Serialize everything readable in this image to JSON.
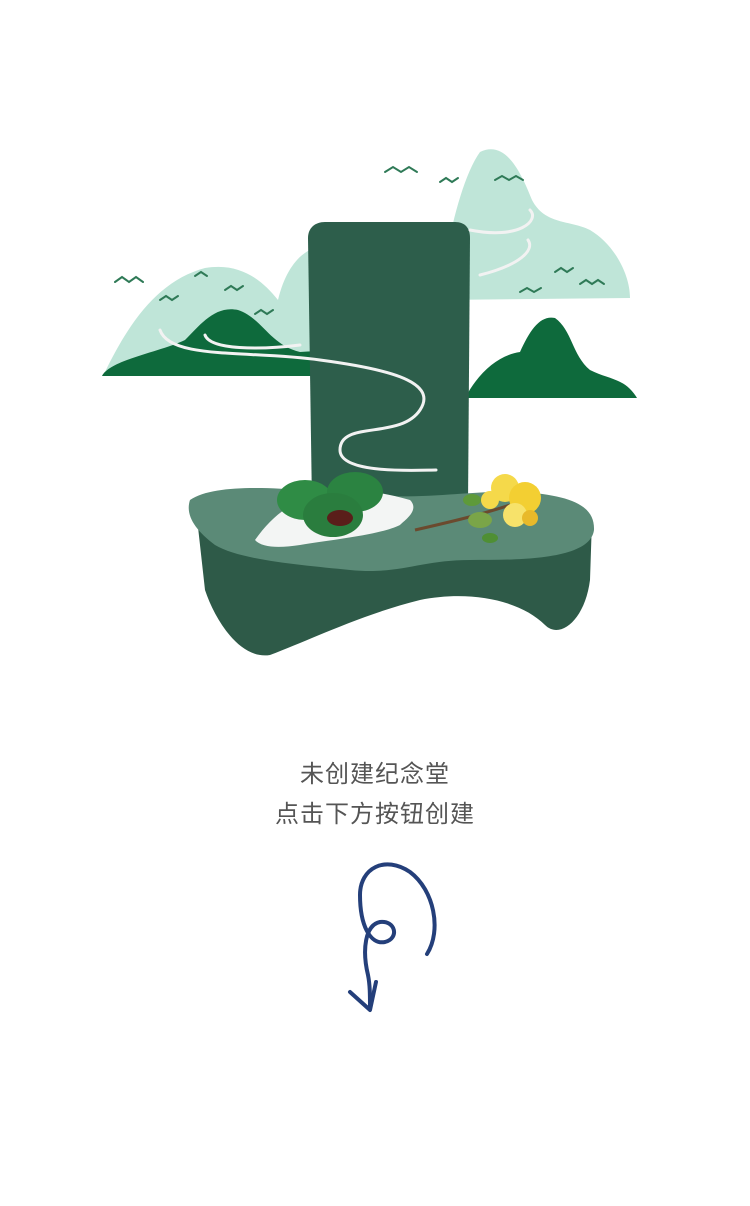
{
  "illustration": {
    "icon": "memorial-hall-illustration-icon",
    "colors": {
      "light_mountain": "#bfe5d8",
      "dark_mountain": "#0e6a3c",
      "stone": "#2d5e4b",
      "base": "#3a6b56",
      "cloth": "#f3f5f4",
      "qingtuan": "#2f8c45",
      "flower": "#f5d94a"
    }
  },
  "empty_state": {
    "line1": "未创建纪念堂",
    "line2": "点击下方按钮创建"
  },
  "arrow": {
    "icon": "curly-down-arrow-icon",
    "color": "#243f7a"
  }
}
